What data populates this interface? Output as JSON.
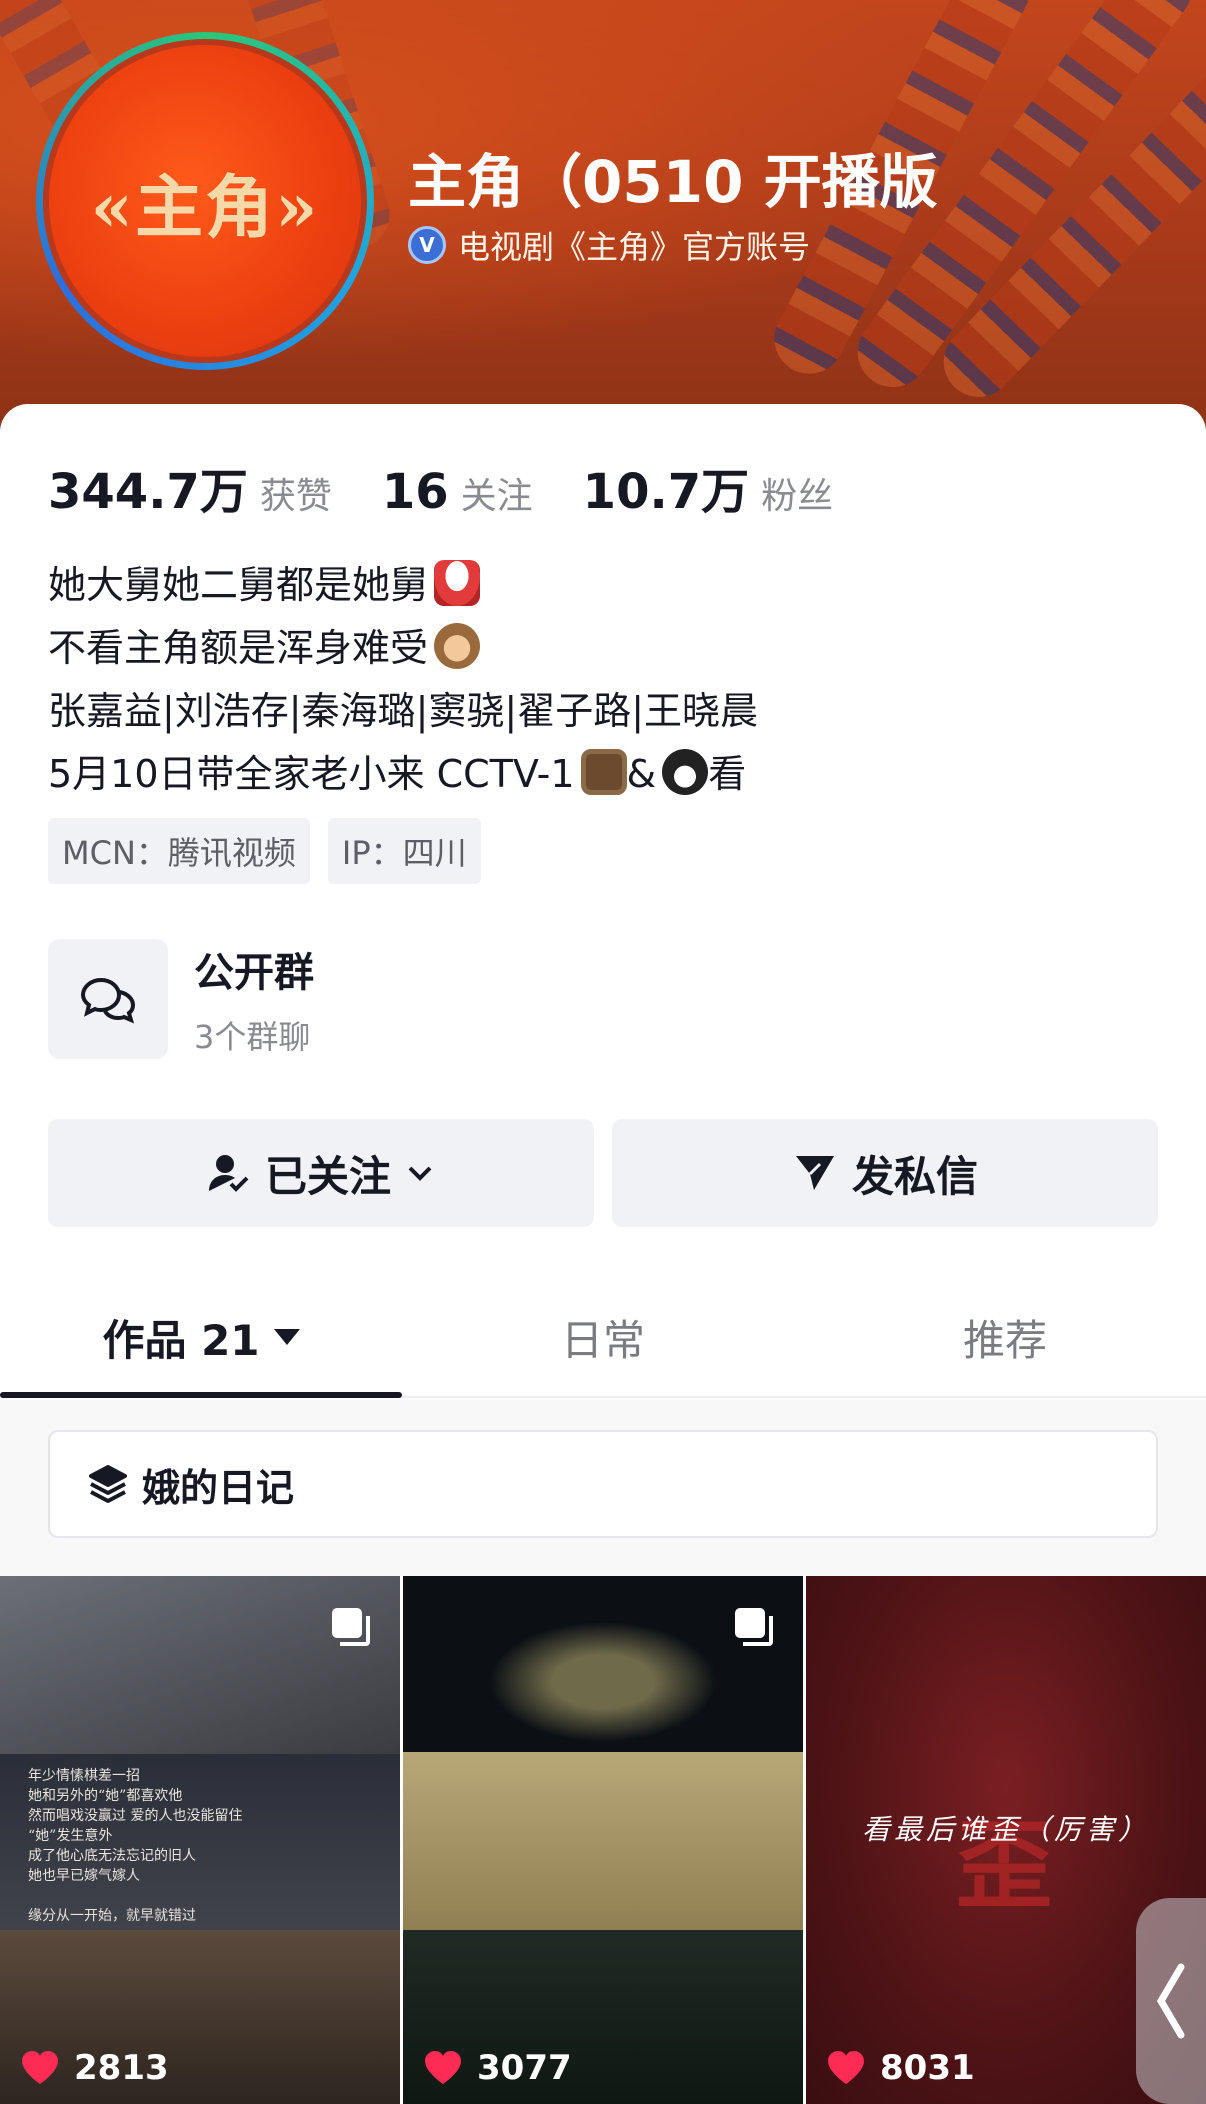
{
  "header": {
    "avatar_text": "«主角»",
    "nickname": "主角（0510 开播版",
    "verify_badge": "V",
    "verify_text": "电视剧《主角》官方账号"
  },
  "stats": {
    "likes_value": "344.7万",
    "likes_label": "获赞",
    "following_value": "16",
    "following_label": "关注",
    "fans_value": "10.7万",
    "fans_label": "粉丝"
  },
  "bio": {
    "line1": "她大舅她二舅都是她舅",
    "line2": "不看主角额是浑身难受",
    "line3": "张嘉益|刘浩存|秦海璐|窦骁|翟子路|王晓晨",
    "line4_a": "5月10日带全家老小来 CCTV-1",
    "line4_b": "&",
    "line4_c": "看"
  },
  "tags": {
    "mcn": "MCN：腾讯视频",
    "ip": "IP：四川"
  },
  "group": {
    "title": "公开群",
    "subtitle": "3个群聊"
  },
  "actions": {
    "follow_label": "已关注",
    "message_label": "发私信"
  },
  "tabs": {
    "works_label": "作品 21",
    "daily_label": "日常",
    "recommend_label": "推荐"
  },
  "collection": {
    "label": "娥的日记"
  },
  "videos": [
    {
      "likes": "2813",
      "caption": "年少情愫棋差一招\n她和另外的“她”都喜欢他\n然而唱戏没赢过 爱的人也没能留住\n“她”发生意外\n成了他心底无法忘记的旧人\n她也早已嫁气嫁人\n\n缘分从一开始，就早就错过"
    },
    {
      "likes": "3077"
    },
    {
      "likes": "8031",
      "overlay": "看最后谁歪（厉害）",
      "big_char": "歪"
    }
  ],
  "icons": {
    "verify": "verified-v-icon",
    "group": "chat-bubbles-icon",
    "follow": "user-check-icon",
    "message": "paper-plane-icon",
    "collection": "layers-icon",
    "multi": "multi-image-icon",
    "heart": "heart-icon",
    "handle": "chevron-left-icon"
  },
  "colors": {
    "banner": "#c3461c",
    "accent_text": "#161823",
    "muted_text": "#8a8b91",
    "heart": "#fe2c55"
  }
}
